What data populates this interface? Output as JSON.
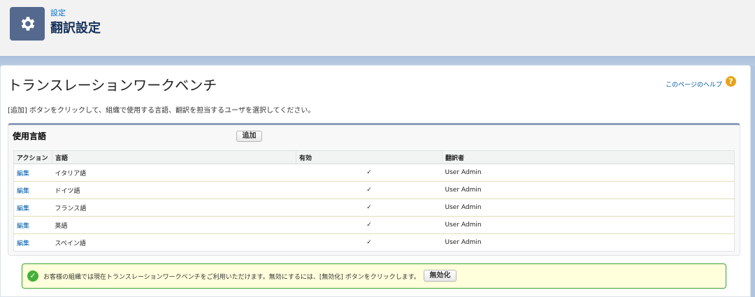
{
  "header": {
    "breadcrumb": "設定",
    "title": "翻訳設定",
    "icon": "gear-icon"
  },
  "page": {
    "heading": "トランスレーションワークベンチ",
    "help_link": "このページのヘルプ",
    "instructions": "[追加] ボタンをクリックして、組織で使用する言語、翻訳を担当するユーザを選択してください。"
  },
  "languages": {
    "title": "使用言語",
    "add_button": "追加",
    "columns": [
      "アクション",
      "言語",
      "有効",
      "翻訳者"
    ],
    "rows": [
      {
        "action": "編集",
        "language": "イタリア語",
        "active": "✓",
        "translator": "User Admin"
      },
      {
        "action": "編集",
        "language": "ドイツ語",
        "active": "✓",
        "translator": "User Admin"
      },
      {
        "action": "編集",
        "language": "フランス語",
        "active": "✓",
        "translator": "User Admin"
      },
      {
        "action": "編集",
        "language": "英語",
        "active": "✓",
        "translator": "User Admin"
      },
      {
        "action": "編集",
        "language": "スペイン語",
        "active": "✓",
        "translator": "User Admin"
      }
    ]
  },
  "message": {
    "text": "お客様の組織では現在トランスレーションワークベンチをご利用いただけます。無効にするには、[無効化] ボタンをクリックします。",
    "button": "無効化",
    "icon": "success-check-icon"
  },
  "colors": {
    "header_icon_bg": "#54698d",
    "link": "#015ba7",
    "success_border": "#39a130",
    "success_bg": "#ffffdc"
  }
}
